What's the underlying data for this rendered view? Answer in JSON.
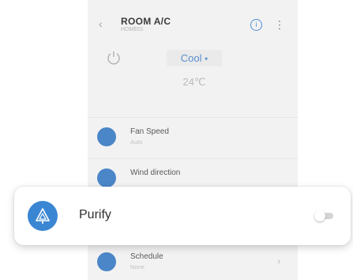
{
  "header": {
    "title": "ROOM A/C",
    "subtitle": "HOME01"
  },
  "mode": {
    "label": "Cool",
    "caret": "▾"
  },
  "temperature": "24℃",
  "rows": [
    {
      "title": "Fan Speed",
      "subtitle": "Auto"
    },
    {
      "title": "Wind direction",
      "subtitle": ""
    },
    {
      "title": "Schedule",
      "subtitle": "None"
    }
  ],
  "highlight": {
    "label": "Purify",
    "toggle_on": false
  },
  "colors": {
    "accent": "#3a86d3",
    "toggle_off": "#d4d4d4"
  }
}
